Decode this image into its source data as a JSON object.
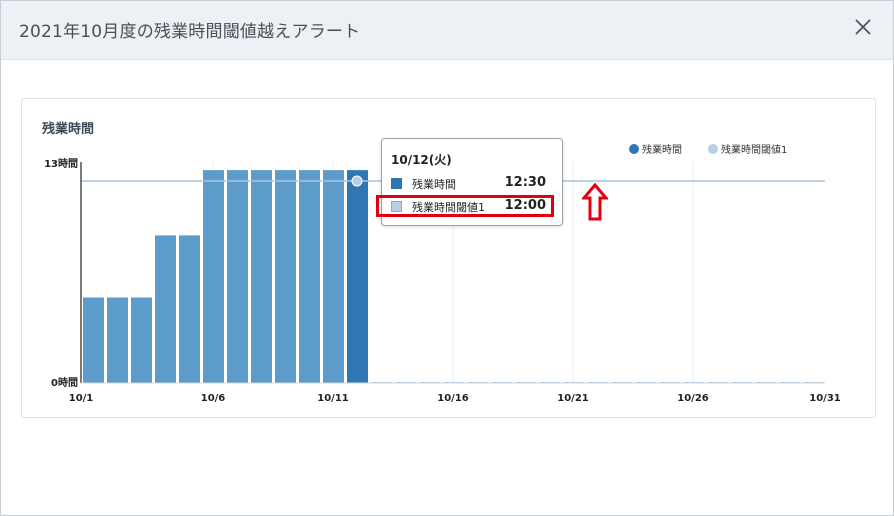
{
  "dialog": {
    "title": "2021年10月度の残業時間閾値越えアラート",
    "close_icon": "close-icon"
  },
  "card": {
    "title": "残業時間"
  },
  "colors": {
    "bar": "#5c9bca",
    "bar_active": "#2f77b4",
    "threshold": "#a8c4e0",
    "highlight": "#e00012"
  },
  "chart_data": {
    "type": "bar",
    "x_categories": [
      "10/1",
      "10/2",
      "10/3",
      "10/4",
      "10/5",
      "10/6",
      "10/7",
      "10/8",
      "10/9",
      "10/10",
      "10/11",
      "10/12",
      "10/13",
      "10/14",
      "10/15",
      "10/16",
      "10/17",
      "10/18",
      "10/19",
      "10/20",
      "10/21",
      "10/22",
      "10/23",
      "10/24",
      "10/25",
      "10/26",
      "10/27",
      "10/28",
      "10/29",
      "10/30",
      "10/31"
    ],
    "x_tick_labels": [
      "10/1",
      "10/6",
      "10/11",
      "10/16",
      "10/21",
      "10/26",
      "10/31"
    ],
    "y_tick_labels": [
      "13時間",
      "0時間"
    ],
    "ylim": [
      0,
      13
    ],
    "series": [
      {
        "name": "残業時間",
        "type": "bar",
        "values": [
          5.5,
          5.5,
          5.5,
          9.5,
          9.5,
          13.7,
          13.7,
          13.7,
          13.7,
          13.7,
          13.7,
          13.7,
          0,
          0,
          0,
          0,
          0,
          0,
          0,
          0,
          0,
          0,
          0,
          0,
          0,
          0,
          0,
          0,
          0,
          0,
          0
        ]
      },
      {
        "name": "残業時間閾値1",
        "type": "line",
        "values": [
          13,
          13,
          13,
          13,
          13,
          13,
          13,
          13,
          13,
          13,
          13,
          13,
          13,
          13,
          13,
          13,
          13,
          13,
          13,
          13,
          13,
          13,
          13,
          13,
          13,
          13,
          13,
          13,
          13,
          13,
          13
        ]
      }
    ],
    "legend": [
      "残業時間",
      "残業時間閾値1"
    ],
    "legend_position": "top-right",
    "active_index": 11,
    "grid": true
  },
  "tooltip": {
    "date": "10/12(火)",
    "rows": [
      {
        "label": "残業時間",
        "value": "12:30"
      },
      {
        "label": "残業時間閾値1",
        "value": "12:00"
      }
    ]
  }
}
